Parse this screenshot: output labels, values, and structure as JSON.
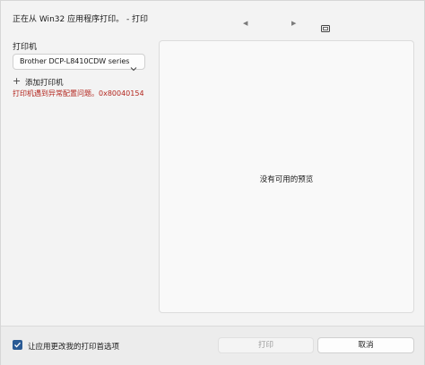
{
  "window": {
    "title": "正在从 Win32 应用程序打印。 - 打印"
  },
  "nav": {
    "prev_icon": "caret-left-icon",
    "prev_glyph": "◀",
    "next_icon": "caret-right-icon",
    "next_glyph": "▶",
    "fit_icon": "fit-page-icon"
  },
  "printer": {
    "label": "打印机",
    "selected": "Brother DCP-L8410CDW series",
    "add_label": "添加打印机",
    "add_glyph": "+",
    "error": "打印机遇到异常配置问题。0x80040154"
  },
  "preview": {
    "message": "没有可用的预览"
  },
  "footer": {
    "checkbox_label": "让应用更改我的打印首选项",
    "checkbox_checked": true,
    "print_label": "打印",
    "cancel_label": "取消"
  },
  "colors": {
    "error": "#b3261e",
    "accent": "#2a5a94"
  }
}
